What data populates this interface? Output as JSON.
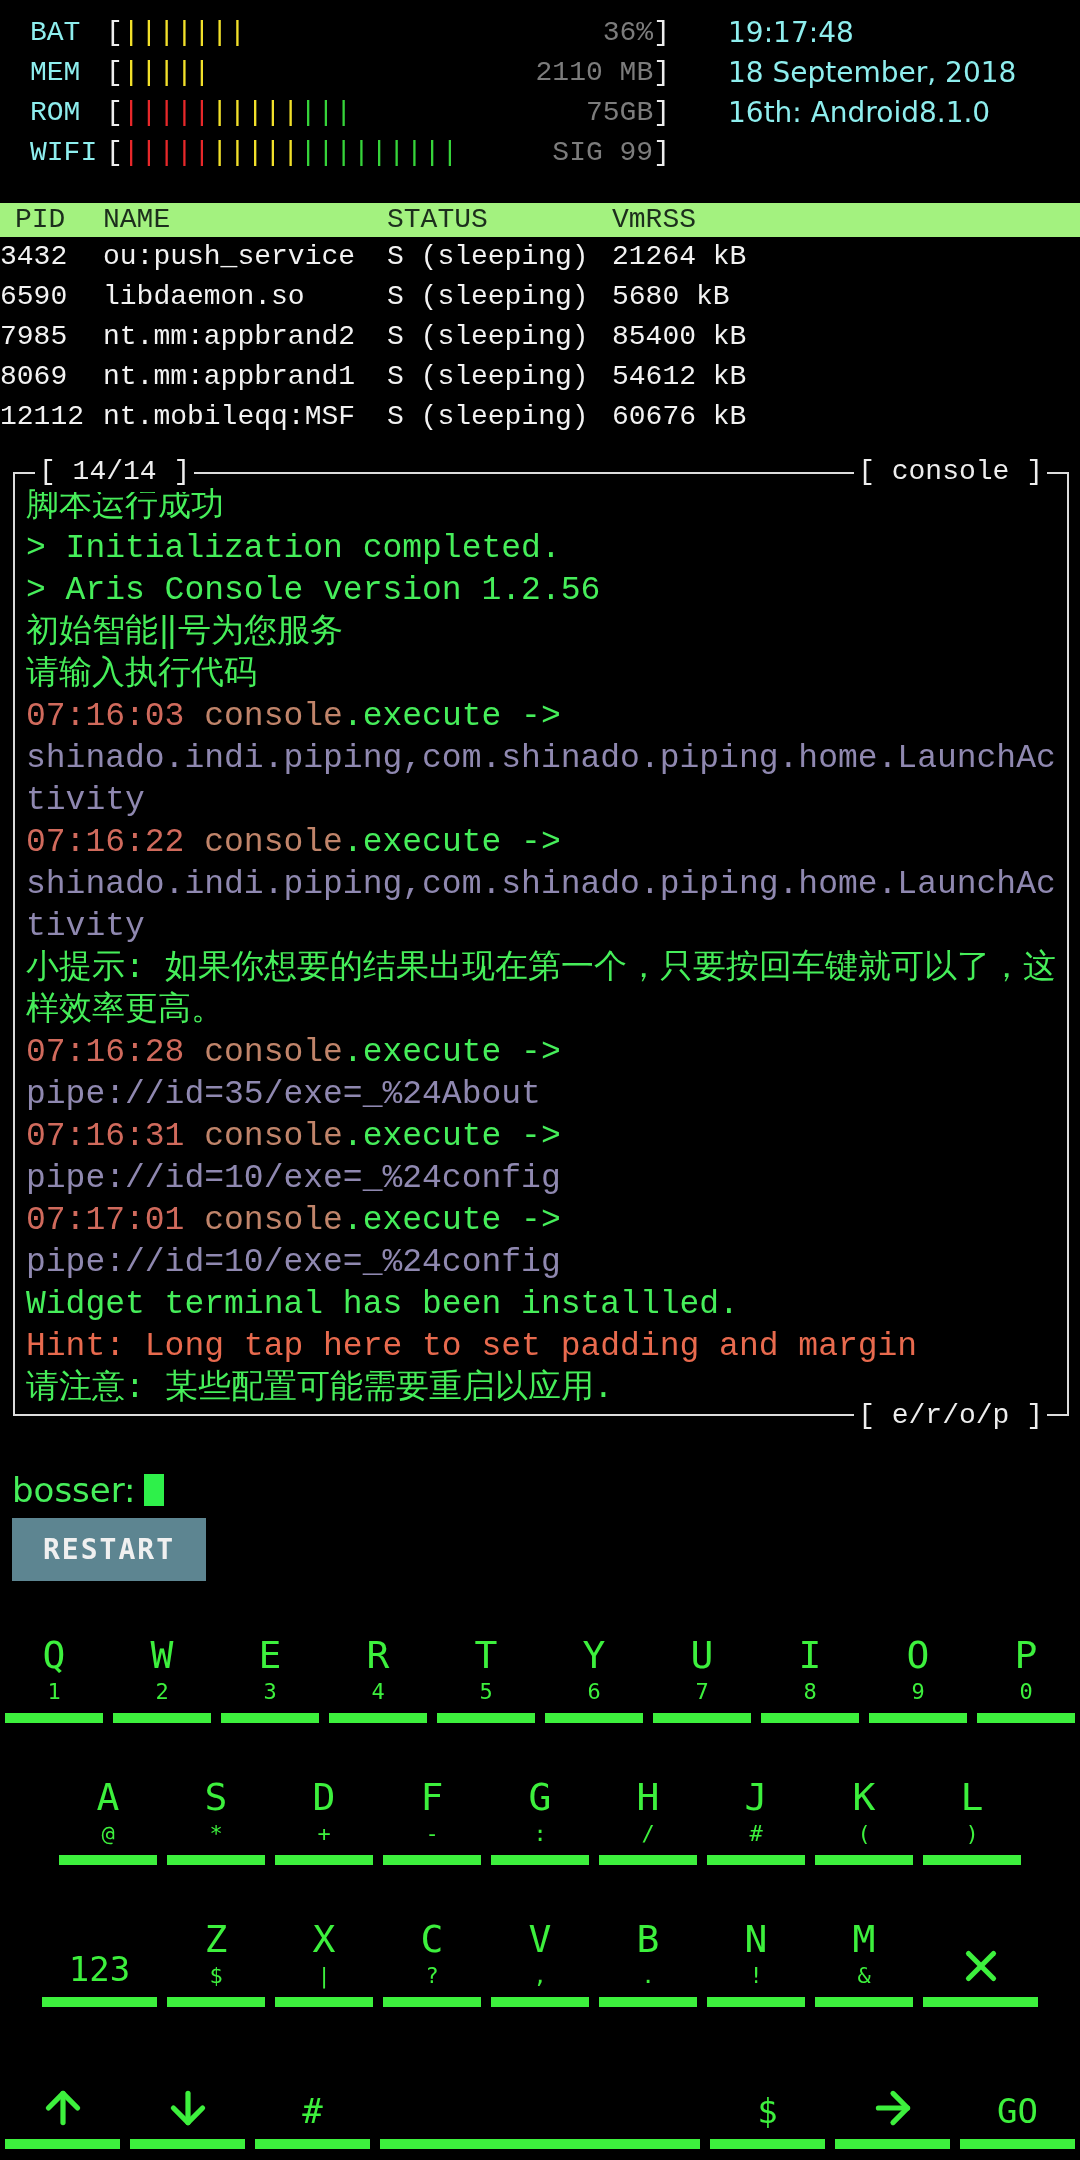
{
  "meters": [
    {
      "label": "BAT",
      "open": "[",
      "bars": [
        {
          "text": "|||||||",
          "color": "#f2e02a"
        }
      ],
      "value": "36%",
      "close": "]"
    },
    {
      "label": "MEM",
      "open": "[",
      "bars": [
        {
          "text": "|||||",
          "color": "#f2e02a"
        }
      ],
      "value": "2110 MB",
      "close": "]"
    },
    {
      "label": "ROM",
      "open": "[",
      "bars": [
        {
          "text": "|||||",
          "color": "#e8282a"
        },
        {
          "text": "|||||",
          "color": "#f2e02a"
        },
        {
          "text": "|||",
          "color": "#36d43a"
        }
      ],
      "value": "75GB",
      "close": "]"
    },
    {
      "label": "WIFI",
      "open": "[",
      "bars": [
        {
          "text": "|||||",
          "color": "#e8282a"
        },
        {
          "text": "|||||",
          "color": "#f2e02a"
        },
        {
          "text": "|||||||||",
          "color": "#36d43a"
        }
      ],
      "value": "SIG 99",
      "close": "]"
    }
  ],
  "clock": {
    "time": "19:17:48",
    "date": "18 September, 2018",
    "device": "16th: Android8.1.0"
  },
  "processes": {
    "columns": [
      "PID",
      "NAME",
      "STATUS",
      "VmRSS"
    ],
    "rows": [
      [
        "3432",
        "ou:push_service",
        "S (sleeping)",
        "21264 kB"
      ],
      [
        "6590",
        "libdaemon.so",
        "S (sleeping)",
        "5680 kB"
      ],
      [
        "7985",
        "nt.mm:appbrand2",
        "S (sleeping)",
        "85400 kB"
      ],
      [
        "8069",
        "nt.mm:appbrand1",
        "S (sleeping)",
        "54612 kB"
      ],
      [
        "12112",
        "nt.mobileqq:MSF",
        "S (sleeping)",
        "60676 kB"
      ]
    ]
  },
  "console": {
    "counter": "[ 14/14 ]",
    "title": "[ console ]",
    "footer": "[ e/r/o/p ]",
    "lines": [
      {
        "kind": "text",
        "text": "脚本运行成功"
      },
      {
        "kind": "text",
        "text": "> Initialization completed."
      },
      {
        "kind": "text",
        "text": "> Aris Console version 1.2.56"
      },
      {
        "kind": "text",
        "text": "初始智能‖号为您服务"
      },
      {
        "kind": "text",
        "text": "请输入执行代码"
      },
      {
        "kind": "exec",
        "time": "07:16:03",
        "source": "console",
        "action": ".execute ->",
        "target": "shinado.indi.piping,com.shinado.piping.home.LaunchActivity"
      },
      {
        "kind": "exec",
        "time": "07:16:22",
        "source": "console",
        "action": ".execute ->",
        "target": "shinado.indi.piping,com.shinado.piping.home.LaunchActivity"
      },
      {
        "kind": "text",
        "text": "小提示: 如果你想要的结果出现在第一个，只要按回车键就可以了，这样效率更高。"
      },
      {
        "kind": "exec",
        "time": "07:16:28",
        "source": "console",
        "action": ".execute ->",
        "target": "pipe://id=35/exe=_%24About"
      },
      {
        "kind": "exec",
        "time": "07:16:31",
        "source": "console",
        "action": ".execute ->",
        "target": "pipe://id=10/exe=_%24config"
      },
      {
        "kind": "exec",
        "time": "07:17:01",
        "source": "console",
        "action": ".execute ->",
        "target": "pipe://id=10/exe=_%24config"
      },
      {
        "kind": "text",
        "text": "Widget terminal has been installled."
      },
      {
        "kind": "hint",
        "text": "Hint: Long tap here to set padding and margin"
      },
      {
        "kind": "text",
        "text": "请注意: 某些配置可能需要重启以应用."
      }
    ]
  },
  "prompt": {
    "label": "bosser:"
  },
  "restart_button": "RESTART",
  "keyboard": [
    {
      "keys": [
        {
          "kind": "char",
          "label": "Q",
          "sub": "1"
        },
        {
          "kind": "char",
          "label": "W",
          "sub": "2"
        },
        {
          "kind": "char",
          "label": "E",
          "sub": "3"
        },
        {
          "kind": "char",
          "label": "R",
          "sub": "4"
        },
        {
          "kind": "char",
          "label": "T",
          "sub": "5"
        },
        {
          "kind": "char",
          "label": "Y",
          "sub": "6"
        },
        {
          "kind": "char",
          "label": "U",
          "sub": "7"
        },
        {
          "kind": "char",
          "label": "I",
          "sub": "8"
        },
        {
          "kind": "char",
          "label": "O",
          "sub": "9"
        },
        {
          "kind": "char",
          "label": "P",
          "sub": "0"
        }
      ]
    },
    {
      "keys": [
        {
          "kind": "char",
          "label": "A",
          "sub": "@"
        },
        {
          "kind": "char",
          "label": "S",
          "sub": "*"
        },
        {
          "kind": "char",
          "label": "D",
          "sub": "+"
        },
        {
          "kind": "char",
          "label": "F",
          "sub": "-"
        },
        {
          "kind": "char",
          "label": "G",
          "sub": ":"
        },
        {
          "kind": "char",
          "label": "H",
          "sub": "/"
        },
        {
          "kind": "char",
          "label": "J",
          "sub": "#"
        },
        {
          "kind": "char",
          "label": "K",
          "sub": "("
        },
        {
          "kind": "char",
          "label": "L",
          "sub": ")"
        }
      ]
    },
    {
      "keys": [
        {
          "kind": "text",
          "label": "123"
        },
        {
          "kind": "char",
          "label": "Z",
          "sub": "$"
        },
        {
          "kind": "char",
          "label": "X",
          "sub": "|"
        },
        {
          "kind": "char",
          "label": "C",
          "sub": "?"
        },
        {
          "kind": "char",
          "label": "V",
          "sub": ","
        },
        {
          "kind": "char",
          "label": "B",
          "sub": "."
        },
        {
          "kind": "char",
          "label": "N",
          "sub": "!"
        },
        {
          "kind": "char",
          "label": "M",
          "sub": "&"
        },
        {
          "kind": "delete"
        }
      ]
    },
    {
      "keys": [
        {
          "kind": "up"
        },
        {
          "kind": "down"
        },
        {
          "kind": "text",
          "label": "#"
        },
        {
          "kind": "space"
        },
        {
          "kind": "text",
          "label": "$"
        },
        {
          "kind": "right"
        },
        {
          "kind": "text",
          "label": "GO"
        }
      ]
    }
  ]
}
